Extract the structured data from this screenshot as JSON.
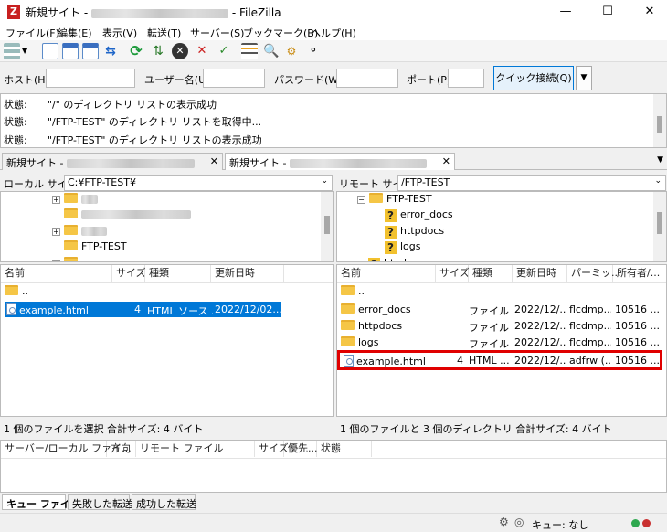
{
  "window": {
    "title_prefix": "新規サイト -",
    "title_suffix": "- FileZilla",
    "minimize": "—",
    "maximize": "☐",
    "close": "✕"
  },
  "menu": [
    "ファイル(F)",
    "編集(E)",
    "表示(V)",
    "転送(T)",
    "サーバー(S)",
    "ブックマーク(B)",
    "ヘルプ(H)"
  ],
  "quickconnect": {
    "host_label": "ホスト(H):",
    "user_label": "ユーザー名(U):",
    "pass_label": "パスワード(W):",
    "port_label": "ポート(P):",
    "button": "クイック接続(Q)",
    "dropdown": "▼"
  },
  "log": [
    {
      "label": "状態:",
      "text": "\"/\" のディレクトリ リストの表示成功"
    },
    {
      "label": "状態:",
      "text": "\"/FTP-TEST\" のディレクトリ リストを取得中..."
    },
    {
      "label": "状態:",
      "text": "\"/FTP-TEST\" のディレクトリ リストの表示成功"
    }
  ],
  "tabs": [
    {
      "label": "新規サイト -",
      "close": "✕"
    },
    {
      "label": "新規サイト -",
      "close": "✕"
    }
  ],
  "tab_dropdown": "▼",
  "local": {
    "site_label": "ローカル サイト:",
    "path": "C:¥FTP-TEST¥",
    "tree_selected": "FTP-TEST",
    "columns": [
      "名前",
      "サイズ",
      "種類",
      "更新日時"
    ],
    "files": [
      {
        "name": "..",
        "size": "",
        "type": "",
        "date": ""
      },
      {
        "name": "example.html",
        "size": "4",
        "type": "HTML ソース ...",
        "date": "2022/12/02..."
      }
    ],
    "status": "1 個のファイルを選択 合計サイズ: 4 バイト"
  },
  "remote": {
    "site_label": "リモート サイト:",
    "path": "/FTP-TEST",
    "tree": [
      "FTP-TEST",
      "error_docs",
      "httpdocs",
      "logs",
      "html"
    ],
    "columns": [
      "名前",
      "サイズ",
      "種類",
      "更新日時",
      "パーミッ...",
      "所有者/..."
    ],
    "files": [
      {
        "name": "..",
        "size": "",
        "type": "",
        "date": "",
        "perm": "",
        "owner": ""
      },
      {
        "name": "error_docs",
        "size": "",
        "type": "ファイル ...",
        "date": "2022/12/...",
        "perm": "flcdmp...",
        "owner": "10516 ..."
      },
      {
        "name": "httpdocs",
        "size": "",
        "type": "ファイル ...",
        "date": "2022/12/...",
        "perm": "flcdmp...",
        "owner": "10516 ..."
      },
      {
        "name": "logs",
        "size": "",
        "type": "ファイル ...",
        "date": "2022/12/...",
        "perm": "flcdmp...",
        "owner": "10516 ..."
      },
      {
        "name": "example.html",
        "size": "4",
        "type": "HTML ...",
        "date": "2022/12/...",
        "perm": "adfrw (...",
        "owner": "10516 ..."
      }
    ],
    "status": "1 個のファイルと 3 個のディレクトリ 合計サイズ: 4 バイト"
  },
  "queue_columns": [
    "サーバー/ローカル ファイ...",
    "方向",
    "リモート ファイル",
    "サイズ",
    "優先...",
    "状態"
  ],
  "bottom_tabs": [
    "キュー ファイル",
    "失敗した転送",
    "成功した転送"
  ],
  "statusbar": {
    "queue": "キュー: なし"
  },
  "colors": {
    "selection": "#0078d7",
    "highlight_box": "#e00000"
  }
}
